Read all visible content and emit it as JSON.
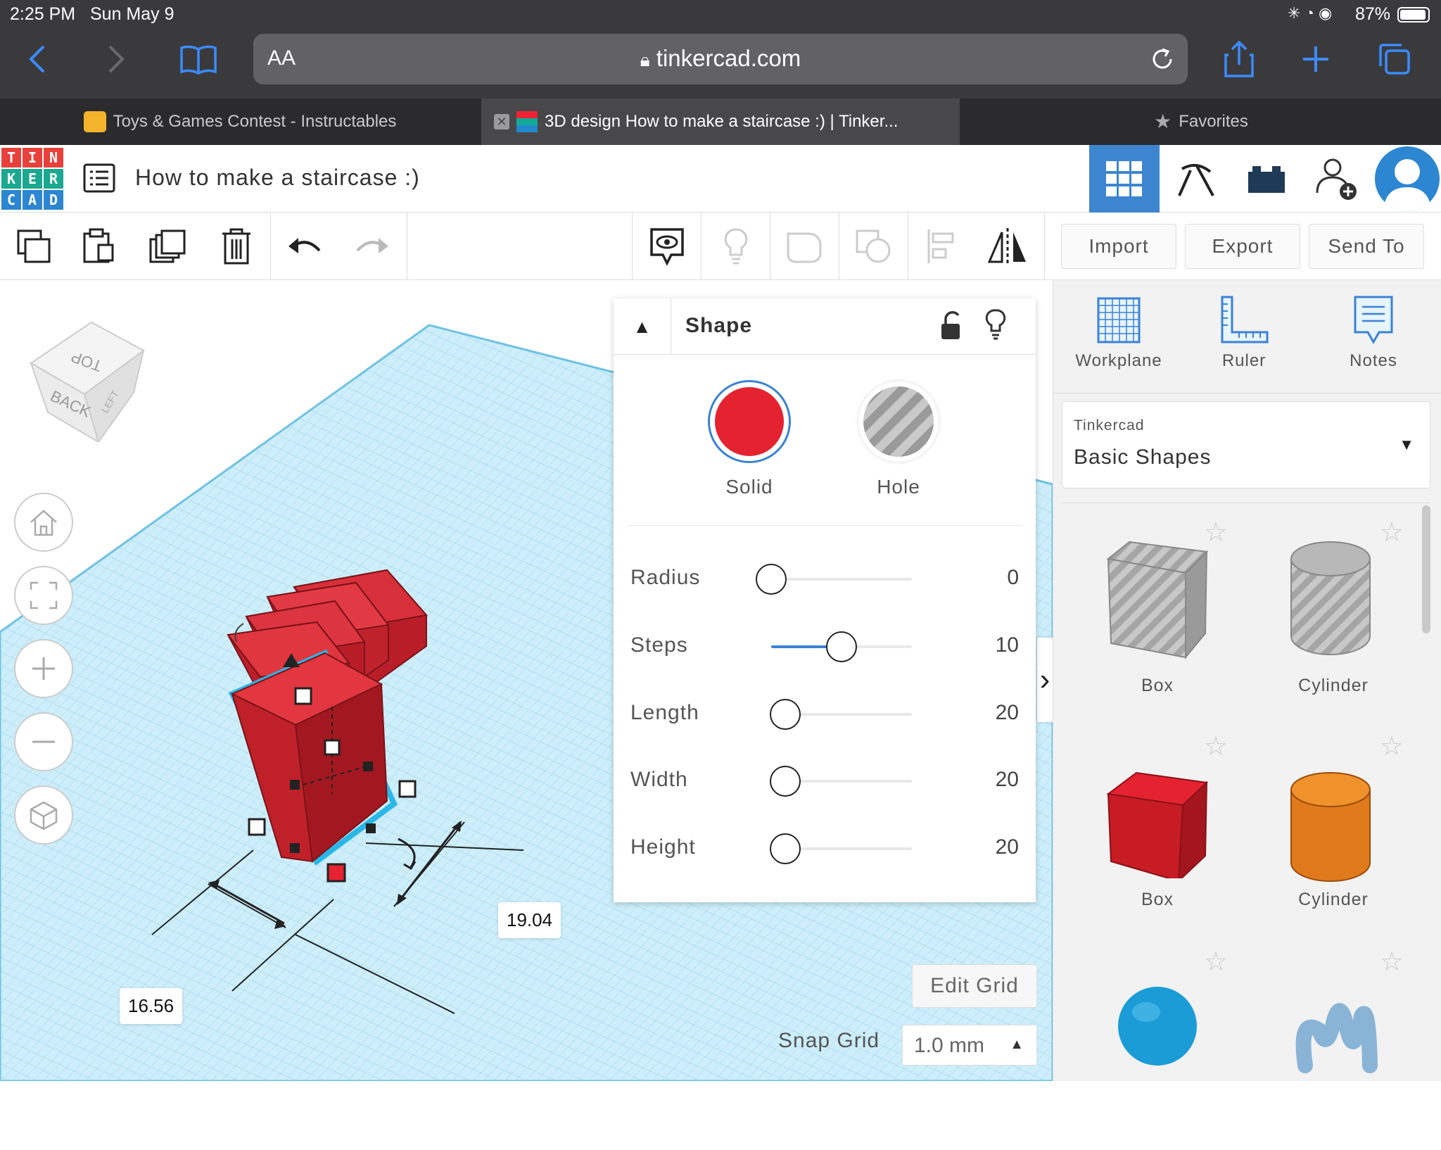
{
  "status": {
    "time": "2:25 PM",
    "date": "Sun May 9",
    "battery": "87%"
  },
  "browser": {
    "aa_label": "AA",
    "url": "tinkercad.com",
    "tabs": [
      {
        "title": "Toys & Games Contest - Instructables"
      },
      {
        "title": "3D design How to make a staircase :) | Tinker..."
      },
      {
        "title": "Favorites"
      }
    ]
  },
  "app": {
    "logo_letters": [
      "T",
      "I",
      "N",
      "K",
      "E",
      "R",
      "C",
      "A",
      "D"
    ],
    "design_title": "How to make a staircase :)"
  },
  "toolbar": {
    "import_label": "Import",
    "export_label": "Export",
    "send_to_label": "Send To"
  },
  "viewcube": {
    "top": "TOP",
    "back": "BACK",
    "left": "LEFT"
  },
  "dimensions": {
    "a": "19.04",
    "b": "16.56"
  },
  "grid": {
    "edit_label": "Edit Grid",
    "snap_label": "Snap Grid",
    "snap_value": "1.0 mm"
  },
  "shape_panel": {
    "title": "Shape",
    "solid_label": "Solid",
    "hole_label": "Hole",
    "params": [
      {
        "label": "Radius",
        "value": "0",
        "fraction": 0.0
      },
      {
        "label": "Steps",
        "value": "10",
        "fraction": 0.5
      },
      {
        "label": "Length",
        "value": "20",
        "fraction": 0.1
      },
      {
        "label": "Width",
        "value": "20",
        "fraction": 0.1
      },
      {
        "label": "Height",
        "value": "20",
        "fraction": 0.1
      }
    ]
  },
  "right_panel": {
    "tools": [
      {
        "label": "Workplane"
      },
      {
        "label": "Ruler"
      },
      {
        "label": "Notes"
      }
    ],
    "library_brand": "Tinkercad",
    "library_name": "Basic Shapes",
    "shapes": [
      {
        "name": "Box"
      },
      {
        "name": "Cylinder"
      },
      {
        "name": "Box"
      },
      {
        "name": "Cylinder"
      }
    ]
  },
  "colors": {
    "accent": "#3b82d6",
    "solid": "#e52230",
    "grid": "#bfe6f5",
    "header_active": "#3d86cf"
  }
}
